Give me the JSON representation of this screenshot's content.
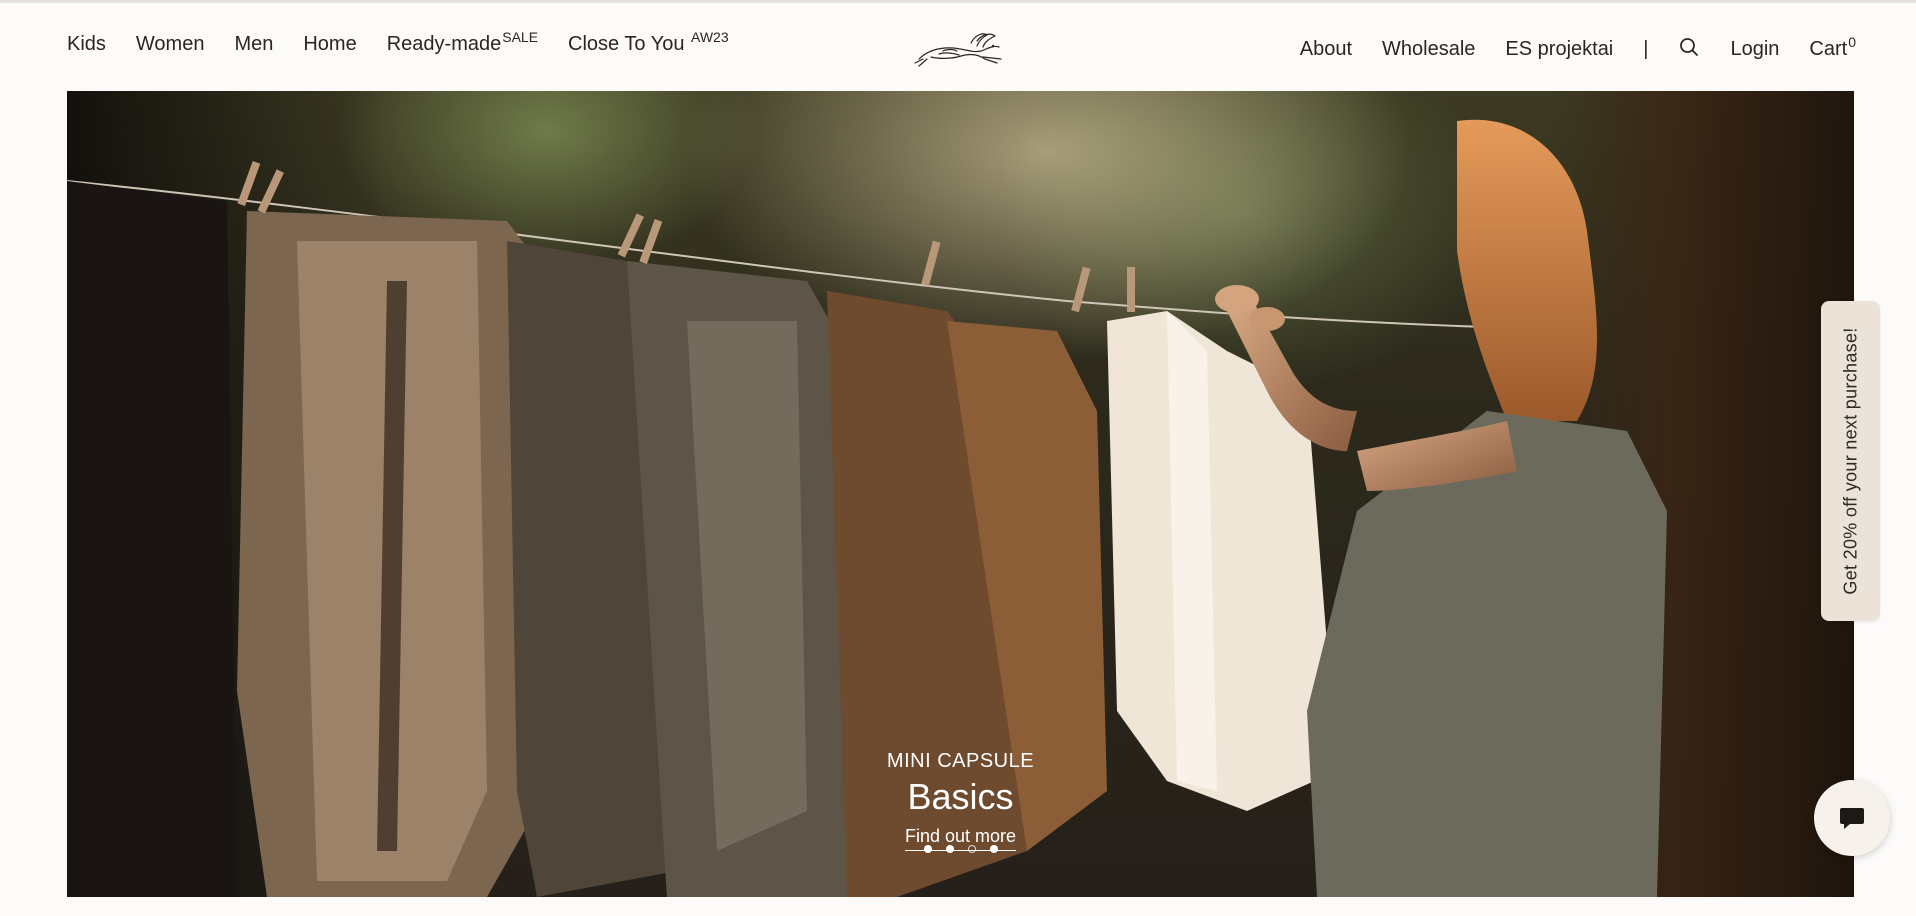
{
  "nav_left": [
    {
      "label": "Kids",
      "sup": ""
    },
    {
      "label": "Women",
      "sup": ""
    },
    {
      "label": "Men",
      "sup": ""
    },
    {
      "label": "Home",
      "sup": ""
    },
    {
      "label": "Ready-made",
      "sup": "SALE"
    },
    {
      "label": "Close To You ",
      "sup": "AW23"
    }
  ],
  "nav_right": {
    "about": "About",
    "wholesale": "Wholesale",
    "es_projects": "ES projektai",
    "separator": "|",
    "search_icon": "search-icon",
    "login": "Login",
    "cart": "Cart",
    "cart_count": "0"
  },
  "logo": {
    "icon": "hare-logo-icon"
  },
  "hero": {
    "kicker": "MINI CAPSULE",
    "title": "Basics",
    "link": "Find out more",
    "slides_total": 4,
    "active_slide": 3
  },
  "promo_tab": {
    "text": "Get 20% off your next purchase!"
  },
  "chat": {
    "icon": "chat-bubble-icon"
  },
  "colors": {
    "background": "#fcfbfa",
    "text": "#2a2622",
    "promo_bg": "#ebe3d8",
    "chat_bg": "#f6f1ea"
  }
}
